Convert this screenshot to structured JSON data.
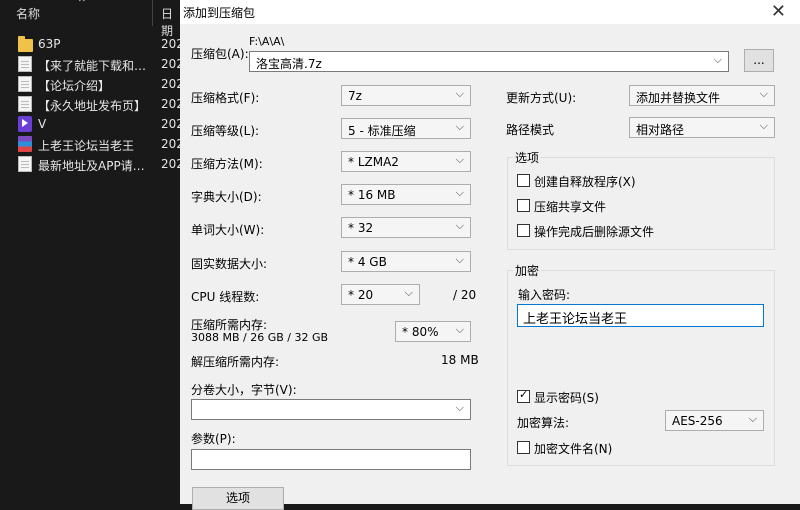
{
  "explorer": {
    "header_name": "名称",
    "header_date": "日期",
    "files": [
      {
        "name": "63P",
        "date": "202",
        "icon": "folder-icon"
      },
      {
        "name": "【来了就能下载和…",
        "date": "202",
        "icon": "document-icon"
      },
      {
        "name": "【论坛介绍】",
        "date": "202",
        "icon": "document-icon"
      },
      {
        "name": "【永久地址发布页】",
        "date": "202",
        "icon": "document-icon"
      },
      {
        "name": "V",
        "date": "202",
        "icon": "mp4-icon"
      },
      {
        "name": "上老王论坛当老王",
        "date": "202",
        "icon": "rar-icon"
      },
      {
        "name": "最新地址及APP请…",
        "date": "202",
        "icon": "document-icon"
      }
    ]
  },
  "dialog": {
    "title": "添加到压缩包",
    "close": "✕",
    "archive": {
      "label": "压缩包(A):",
      "path": "F:\\A\\A\\",
      "name": "洛宝高清.7z",
      "browse": "..."
    },
    "format": {
      "label": "压缩格式(F):",
      "value": "7z"
    },
    "level": {
      "label": "压缩等级(L):",
      "value": "5 - 标准压缩"
    },
    "method": {
      "label": "压缩方法(M):",
      "value": "* LZMA2"
    },
    "dict": {
      "label": "字典大小(D):",
      "value": "* 16 MB"
    },
    "word": {
      "label": "单词大小(W):",
      "value": "* 32"
    },
    "solid": {
      "label": "固实数据大小:",
      "value": "* 4 GB"
    },
    "cpu": {
      "label": "CPU 线程数:",
      "value": "* 20",
      "total": "/ 20"
    },
    "mem_compress": {
      "label": "压缩所需内存:",
      "detail": "3088 MB / 26 GB / 32 GB",
      "value": "* 80%"
    },
    "mem_decompress": {
      "label": "解压缩所需内存:",
      "value": "18 MB"
    },
    "volume": {
      "label": "分卷大小，字节(V):",
      "value": ""
    },
    "params": {
      "label": "参数(P):",
      "value": ""
    },
    "options_button": "选项",
    "update": {
      "label": "更新方式(U):",
      "value": "添加并替换文件"
    },
    "path_mode": {
      "label": "路径模式",
      "value": "相对路径"
    },
    "options": {
      "title": "选项",
      "sfx": {
        "label": "创建自释放程序(X)",
        "checked": false
      },
      "shared": {
        "label": "压缩共享文件",
        "checked": false
      },
      "delete": {
        "label": "操作完成后删除源文件",
        "checked": false
      }
    },
    "encryption": {
      "title": "加密",
      "password_label": "输入密码:",
      "password": "上老王论坛当老王",
      "show_password": {
        "label": "显示密码(S)",
        "checked": true
      },
      "method_label": "加密算法:",
      "method": "AES-256",
      "encrypt_names": {
        "label": "加密文件名(N)",
        "checked": false
      }
    }
  }
}
